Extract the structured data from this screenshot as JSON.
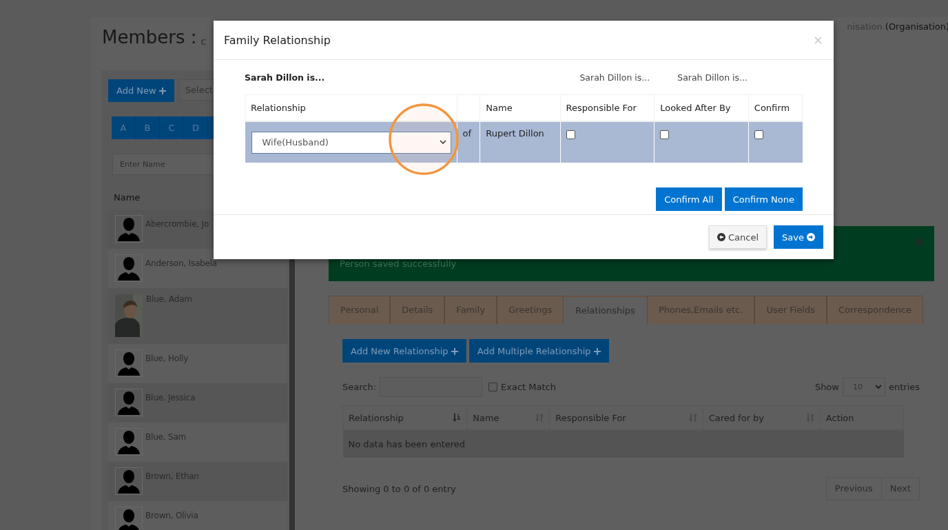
{
  "page": {
    "title": "Members :",
    "subtitle": "c",
    "org": "nisation",
    "org_type": "(Organisation)"
  },
  "sidebar": {
    "add_button": "Add New",
    "select": "Select",
    "letters": [
      "A",
      "B",
      "C",
      "D"
    ],
    "name_placeholder": "Enter Name",
    "name_header": "Name",
    "members": [
      {
        "name": "Abercrombie, Jo",
        "kind": "silhouette"
      },
      {
        "name": "Anderson, Isabela",
        "kind": "silhouette"
      },
      {
        "name": "Blue, Adam"
      },
      {
        "name": "Blue, Holly",
        "kind": "silhouette"
      },
      {
        "name": "Blue, Jessica",
        "kind": "silhouette"
      },
      {
        "name": "Blue, Sam",
        "kind": "silhouette"
      },
      {
        "name": "Brown, Ethan",
        "kind": "silhouette"
      },
      {
        "name": "Brown, Olivia",
        "kind": "silhouette"
      }
    ]
  },
  "alert": {
    "message": "Person saved successfully"
  },
  "tabs": [
    {
      "label": "Personal",
      "selected": false
    },
    {
      "label": "Details",
      "selected": false
    },
    {
      "label": "Family",
      "selected": false
    },
    {
      "label": "Greetings",
      "selected": false
    },
    {
      "label": "Relationships",
      "selected": true
    },
    {
      "label": "Phones,Emails etc.",
      "selected": false
    },
    {
      "label": "User Fields",
      "selected": false
    },
    {
      "label": "Correspondence",
      "selected": false
    }
  ],
  "relationships": {
    "buttons": [
      "Add New Relationship",
      "Add Multiple Relationship"
    ],
    "search_label": "Search:",
    "exact_match": {
      "label": "Exact Match",
      "checked": false
    },
    "show_label": "Show",
    "page_size": "10",
    "entries_label": "entries",
    "columns": [
      {
        "label": "Relationship",
        "kind": "sorted"
      },
      {
        "label": "Name",
        "kind": "sortable"
      },
      {
        "label": "Responsible For",
        "kind": "sortable"
      },
      {
        "label": "Cared for by",
        "kind": "sortable"
      },
      {
        "label": "Action",
        "kind": "plain"
      }
    ],
    "empty": "No data has been entered",
    "info": "Showing 0 to 0 of 0 entry",
    "pager": [
      "Previous",
      "Next"
    ]
  },
  "modal": {
    "title": "Family Relationship",
    "subject": "Sarah Dillon is...",
    "column_notes": [
      "Sarah Dillon is...",
      "Sarah Dillon is..."
    ],
    "columns": [
      "Relationship",
      "Name",
      "Responsible For",
      "Looked After By",
      "Confirm"
    ],
    "rows": [
      {
        "relationship": "Wife(Husband)",
        "connector": "of",
        "name": "Rupert Dillon",
        "responsible_for": false,
        "looked_after_by": false,
        "confirm": false
      }
    ],
    "buttons": [
      "Confirm All",
      "Confirm None"
    ],
    "cancel": "Cancel",
    "save": "Save"
  }
}
